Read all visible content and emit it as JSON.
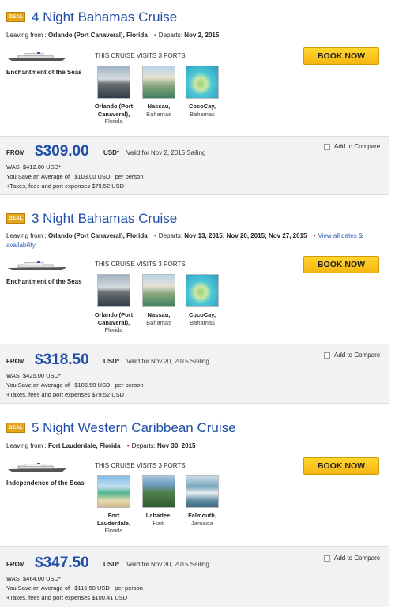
{
  "deal_badge": "DEAL",
  "labels": {
    "leaving_from": "Leaving from :",
    "departs": "Departs:",
    "visits": "THIS CRUISE VISITS 3 PORTS",
    "book_now": "BOOK NOW",
    "from": "FROM",
    "usd": "USD*",
    "add_to_compare": "Add to Compare",
    "was": "WAS",
    "save_avg": "You Save an Average of",
    "per_person": "per person"
  },
  "cruises": [
    {
      "title": "4 Night Bahamas Cruise",
      "origin": "Orlando (Port Canaveral), Florida",
      "departs": "Nov 2, 2015",
      "view_all": "",
      "ship": "Enchantment of the Seas",
      "ports": [
        {
          "name": "Orlando (Port Canaveral),",
          "country": "Florida",
          "icon": "pier-photo"
        },
        {
          "name": "Nassau,",
          "country": "Bahamas",
          "icon": "resort-photo"
        },
        {
          "name": "CocoCay,",
          "country": "Bahamas",
          "icon": "island-aerial-photo"
        }
      ],
      "price": "$309.00",
      "valid": "Valid for Nov 2, 2015 Sailing",
      "was_price": "$412.00 USD*",
      "save": "$103.00 USD",
      "taxes": "+Taxes, fees and port expenses $79.52 USD"
    },
    {
      "title": "3 Night Bahamas Cruise",
      "origin": "Orlando (Port Canaveral), Florida",
      "departs": "Nov 13, 2015; Nov 20, 2015; Nov 27, 2015",
      "view_all": "View all dates & availability",
      "ship": "Enchantment of the Seas",
      "ports": [
        {
          "name": "Orlando (Port Canaveral),",
          "country": "Florida",
          "icon": "pier-photo"
        },
        {
          "name": "Nassau,",
          "country": "Bahamas",
          "icon": "resort-photo"
        },
        {
          "name": "CocoCay,",
          "country": "Bahamas",
          "icon": "island-aerial-photo"
        }
      ],
      "price": "$318.50",
      "valid": "Valid for Nov 20, 2015 Sailing",
      "was_price": "$425.00 USD*",
      "save": "$106.50 USD",
      "taxes": "+Taxes, fees and port expenses $79.52 USD"
    },
    {
      "title": "5 Night Western Caribbean Cruise",
      "origin": "Fort Lauderdale, Florida",
      "departs": "Nov 30, 2015",
      "view_all": "",
      "ship": "Independence of the Seas",
      "ports": [
        {
          "name": "Fort Lauderdale,",
          "country": "Florida",
          "icon": "beach-photo"
        },
        {
          "name": "Labadee,",
          "country": "Haiti",
          "icon": "coast-photo"
        },
        {
          "name": "Falmouth,",
          "country": "Jamaica",
          "icon": "waterfall-photo"
        }
      ],
      "price": "$347.50",
      "valid": "Valid for Nov 30, 2015 Sailing",
      "was_price": "$464.00 USD*",
      "save": "$116.50 USD",
      "taxes": "+Taxes, fees and port expenses $100.41 USD"
    }
  ]
}
